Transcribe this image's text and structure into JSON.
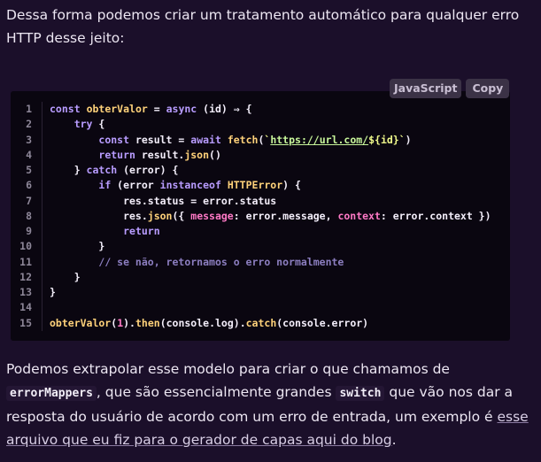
{
  "intro": {
    "text": "Dessa forma podemos criar um tratamento automático para qualquer erro HTTP desse jeito:"
  },
  "code_block": {
    "language_label": "JavaScript",
    "copy_label": "Copy",
    "line_numbers": [
      "1",
      "2",
      "3",
      "4",
      "5",
      "6",
      "7",
      "8",
      "9",
      "10",
      "11",
      "12",
      "13",
      "14",
      "15"
    ]
  },
  "outro": {
    "part1": "Podemos extrapolar esse modelo para criar o que chamamos de ",
    "code1": "errorMappers",
    "part2": ", que são essencialmente grandes ",
    "code2": "switch",
    "part3": " que vão nos dar a resposta do usuário de acordo com um erro de entrada, um exemplo é ",
    "link": "esse arquivo que eu fiz para o gerador de capas aqui do blog",
    "part4": "."
  }
}
